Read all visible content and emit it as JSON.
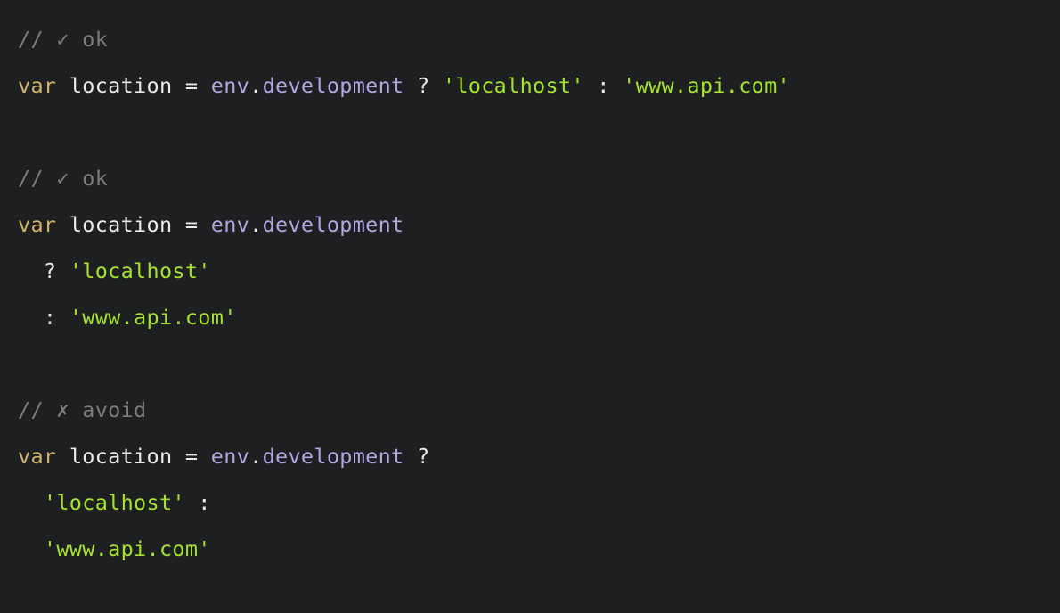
{
  "colors": {
    "background": "#1d1f21",
    "comment": "#7c7c7c",
    "keyword": "#cfb46a",
    "identifier": "#eceae6",
    "operator": "#eceae6",
    "object": "#b3a6e0",
    "string": "#a6e22e"
  },
  "code_lines": [
    [
      {
        "t": "comment",
        "v": "// ✓ ok"
      }
    ],
    [
      {
        "t": "keyword",
        "v": "var"
      },
      {
        "t": "space",
        "v": " "
      },
      {
        "t": "ident",
        "v": "location"
      },
      {
        "t": "space",
        "v": " "
      },
      {
        "t": "op",
        "v": "="
      },
      {
        "t": "space",
        "v": " "
      },
      {
        "t": "obj",
        "v": "env"
      },
      {
        "t": "op",
        "v": "."
      },
      {
        "t": "obj",
        "v": "development"
      },
      {
        "t": "space",
        "v": " "
      },
      {
        "t": "qmark",
        "v": "?"
      },
      {
        "t": "space",
        "v": " "
      },
      {
        "t": "string",
        "v": "'localhost'"
      },
      {
        "t": "space",
        "v": " "
      },
      {
        "t": "qmark",
        "v": ":"
      },
      {
        "t": "space",
        "v": " "
      },
      {
        "t": "string",
        "v": "'www.api.com'"
      }
    ],
    [],
    [
      {
        "t": "comment",
        "v": "// ✓ ok"
      }
    ],
    [
      {
        "t": "keyword",
        "v": "var"
      },
      {
        "t": "space",
        "v": " "
      },
      {
        "t": "ident",
        "v": "location"
      },
      {
        "t": "space",
        "v": " "
      },
      {
        "t": "op",
        "v": "="
      },
      {
        "t": "space",
        "v": " "
      },
      {
        "t": "obj",
        "v": "env"
      },
      {
        "t": "op",
        "v": "."
      },
      {
        "t": "obj",
        "v": "development"
      }
    ],
    [
      {
        "t": "space",
        "v": "  "
      },
      {
        "t": "qmark",
        "v": "?"
      },
      {
        "t": "space",
        "v": " "
      },
      {
        "t": "string",
        "v": "'localhost'"
      }
    ],
    [
      {
        "t": "space",
        "v": "  "
      },
      {
        "t": "qmark",
        "v": ":"
      },
      {
        "t": "space",
        "v": " "
      },
      {
        "t": "string",
        "v": "'www.api.com'"
      }
    ],
    [],
    [
      {
        "t": "comment",
        "v": "// ✗ avoid"
      }
    ],
    [
      {
        "t": "keyword",
        "v": "var"
      },
      {
        "t": "space",
        "v": " "
      },
      {
        "t": "ident",
        "v": "location"
      },
      {
        "t": "space",
        "v": " "
      },
      {
        "t": "op",
        "v": "="
      },
      {
        "t": "space",
        "v": " "
      },
      {
        "t": "obj",
        "v": "env"
      },
      {
        "t": "op",
        "v": "."
      },
      {
        "t": "obj",
        "v": "development"
      },
      {
        "t": "space",
        "v": " "
      },
      {
        "t": "qmark",
        "v": "?"
      }
    ],
    [
      {
        "t": "space",
        "v": "  "
      },
      {
        "t": "string",
        "v": "'localhost'"
      },
      {
        "t": "space",
        "v": " "
      },
      {
        "t": "qmark",
        "v": ":"
      }
    ],
    [
      {
        "t": "space",
        "v": "  "
      },
      {
        "t": "string",
        "v": "'www.api.com'"
      }
    ]
  ]
}
